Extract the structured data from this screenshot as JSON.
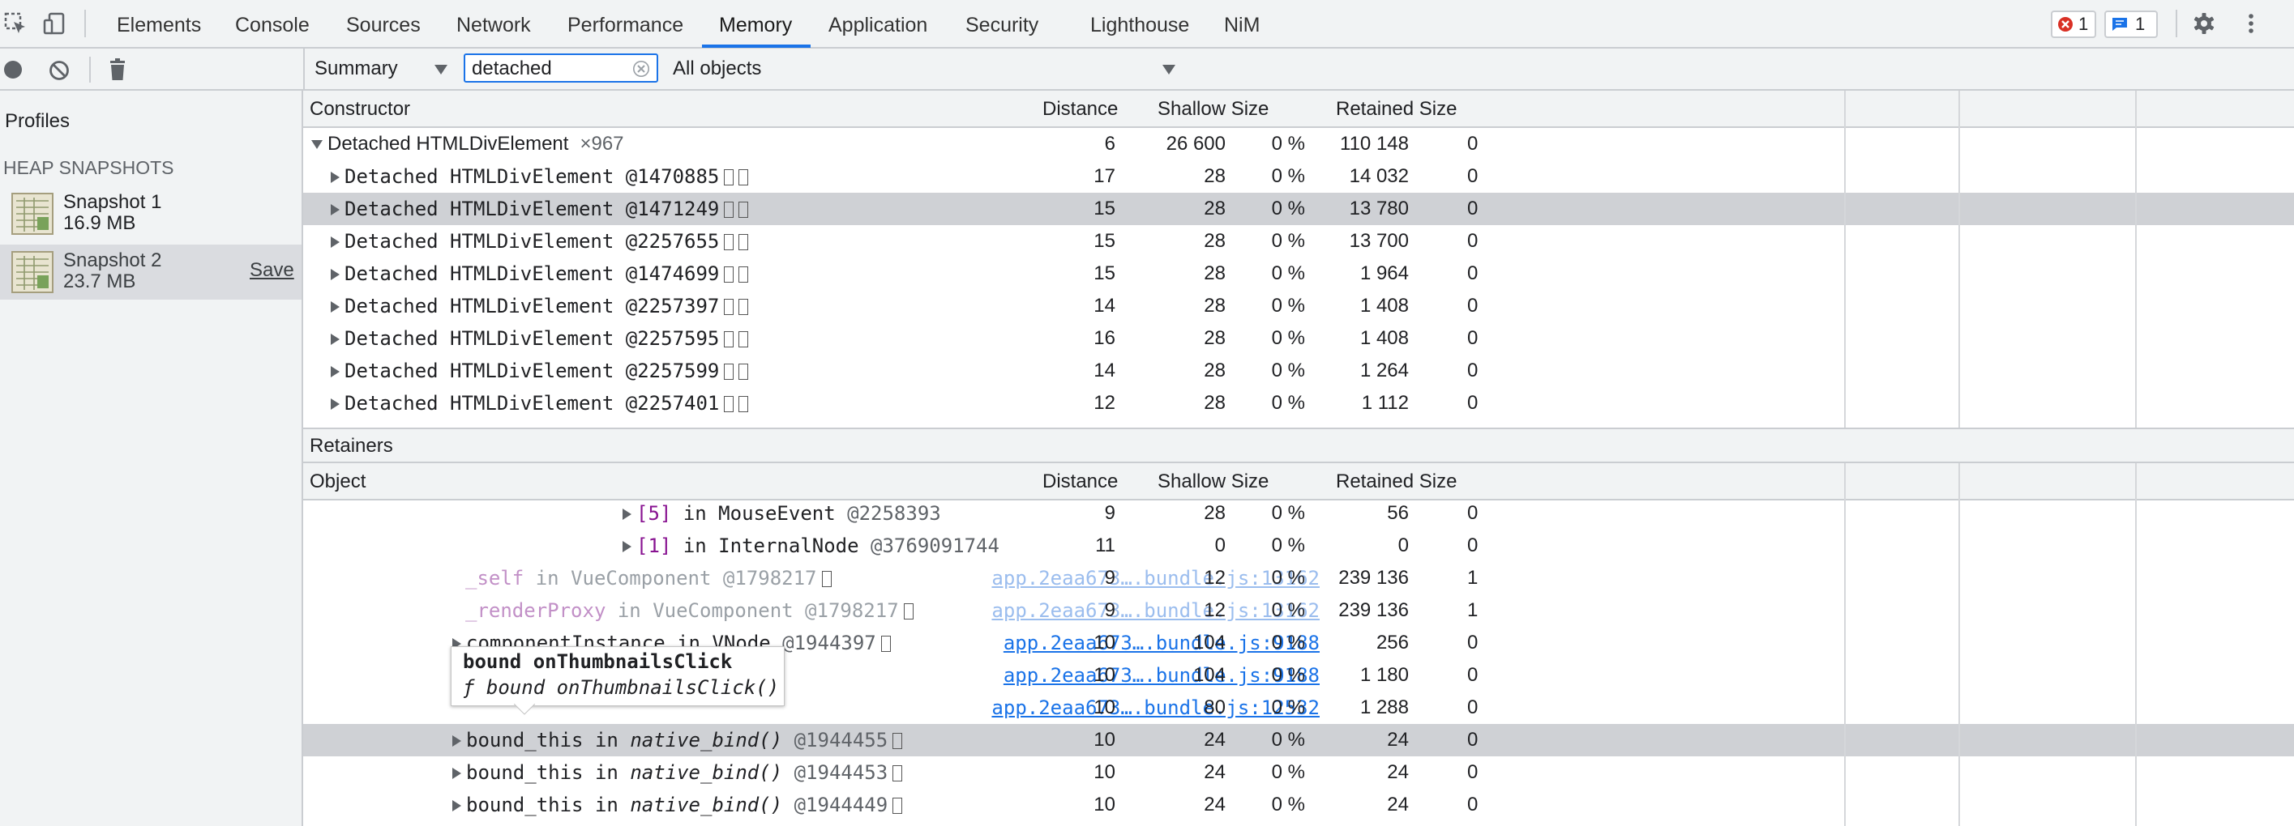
{
  "tabs": {
    "items": [
      "Elements",
      "Console",
      "Sources",
      "Network",
      "Performance",
      "Memory",
      "Application",
      "Security",
      "Lighthouse",
      "NiM"
    ],
    "active": "Memory"
  },
  "badges": {
    "errors": "1",
    "messages": "1"
  },
  "toolbar": {
    "view_select": "Summary",
    "filter_value": "detached",
    "objects_select": "All objects"
  },
  "sidebar": {
    "profiles_label": "Profiles",
    "section_label": "HEAP SNAPSHOTS",
    "snapshots": [
      {
        "title": "Snapshot 1",
        "size": "16.9 MB"
      },
      {
        "title": "Snapshot 2",
        "size": "23.7 MB",
        "save_label": "Save"
      }
    ]
  },
  "constructor_table": {
    "headers": [
      "Constructor",
      "Distance",
      "Shallow Size",
      "Retained Size"
    ],
    "group": {
      "name": "Detached HTMLDivElement",
      "count": "×967",
      "distance": "6",
      "shallow": "26 600",
      "shallow_pct": "0 %",
      "retained": "110 148",
      "retained_pct": "0"
    },
    "rows": [
      {
        "name": "Detached HTMLDivElement @1470885",
        "distance": "17",
        "shallow": "28",
        "shallow_pct": "0 %",
        "retained": "14 032",
        "retained_pct": "0"
      },
      {
        "name": "Detached HTMLDivElement @1471249",
        "distance": "15",
        "shallow": "28",
        "shallow_pct": "0 %",
        "retained": "13 780",
        "retained_pct": "0"
      },
      {
        "name": "Detached HTMLDivElement @2257655",
        "distance": "15",
        "shallow": "28",
        "shallow_pct": "0 %",
        "retained": "13 700",
        "retained_pct": "0"
      },
      {
        "name": "Detached HTMLDivElement @1474699",
        "distance": "15",
        "shallow": "28",
        "shallow_pct": "0 %",
        "retained": "1 964",
        "retained_pct": "0"
      },
      {
        "name": "Detached HTMLDivElement @2257397",
        "distance": "14",
        "shallow": "28",
        "shallow_pct": "0 %",
        "retained": "1 408",
        "retained_pct": "0"
      },
      {
        "name": "Detached HTMLDivElement @2257595",
        "distance": "16",
        "shallow": "28",
        "shallow_pct": "0 %",
        "retained": "1 408",
        "retained_pct": "0"
      },
      {
        "name": "Detached HTMLDivElement @2257599",
        "distance": "14",
        "shallow": "28",
        "shallow_pct": "0 %",
        "retained": "1 264",
        "retained_pct": "0"
      },
      {
        "name": "Detached HTMLDivElement @2257401",
        "distance": "12",
        "shallow": "28",
        "shallow_pct": "0 %",
        "retained": "1 112",
        "retained_pct": "0"
      }
    ]
  },
  "retainers": {
    "title": "Retainers",
    "headers": [
      "Object",
      "Distance",
      "Shallow Size",
      "Retained Size"
    ],
    "rows": [
      {
        "key": "[5]",
        "in": "in",
        "type": "MouseEvent",
        "id": "@2258393",
        "link": "",
        "distance": "9",
        "shallow": "28",
        "shallow_pct": "0 %",
        "retained": "56",
        "retained_pct": "0"
      },
      {
        "key": "[1]",
        "in": "in",
        "type": "InternalNode",
        "id": "@3769091744",
        "link": "",
        "distance": "11",
        "shallow": "0",
        "shallow_pct": "0 %",
        "retained": "0",
        "retained_pct": "0"
      },
      {
        "key": "_self",
        "in": "in",
        "type": "VueComponent",
        "id": "@1798217",
        "link": "app.2eaa673….bundle.js:13162",
        "distance": "9",
        "shallow": "12",
        "shallow_pct": "0 %",
        "retained": "239 136",
        "retained_pct": "1"
      },
      {
        "key": "_renderProxy",
        "in": "in",
        "type": "VueComponent",
        "id": "@1798217",
        "link": "app.2eaa673….bundle.js:13162",
        "distance": "9",
        "shallow": "12",
        "shallow_pct": "0 %",
        "retained": "239 136",
        "retained_pct": "1"
      },
      {
        "key": "componentInstance",
        "in": "in",
        "type": "VNode",
        "id": "@1944397",
        "link": "app.2eaa673….bundle.js:9188",
        "distance": "10",
        "shallow": "104",
        "shallow_pct": "0 %",
        "retained": "256",
        "retained_pct": "0"
      },
      {
        "key": "",
        "in": "",
        "type": "",
        "id": "",
        "link": "app.2eaa673….bundle.js:9188",
        "distance": "10",
        "shallow": "104",
        "shallow_pct": "0 %",
        "retained": "1 180",
        "retained_pct": "0"
      },
      {
        "key": "",
        "in": "",
        "type": "",
        "id": "",
        "link": "app.2eaa673….bundle.js:12532",
        "distance": "10",
        "shallow": "80",
        "shallow_pct": "0 %",
        "retained": "1 288",
        "retained_pct": "0"
      },
      {
        "key": "bound_this",
        "in": "in",
        "type": "native_bind()",
        "id": "@1944455",
        "link": "",
        "distance": "10",
        "shallow": "24",
        "shallow_pct": "0 %",
        "retained": "24",
        "retained_pct": "0"
      },
      {
        "key": "bound_this",
        "in": "in",
        "type": "native_bind()",
        "id": "@1944453",
        "link": "",
        "distance": "10",
        "shallow": "24",
        "shallow_pct": "0 %",
        "retained": "24",
        "retained_pct": "0"
      },
      {
        "key": "bound_this",
        "in": "in",
        "type": "native_bind()",
        "id": "@1944449",
        "link": "",
        "distance": "10",
        "shallow": "24",
        "shallow_pct": "0 %",
        "retained": "24",
        "retained_pct": "0"
      }
    ]
  },
  "tooltip": {
    "title": "bound onThumbnailsClick",
    "f_glyph": "ƒ",
    "signature": "bound onThumbnailsClick()"
  },
  "colors": {
    "accent": "#1a73e8",
    "error": "#d93025",
    "selected_row": "#cfd1d5",
    "key_purple": "#881391"
  }
}
